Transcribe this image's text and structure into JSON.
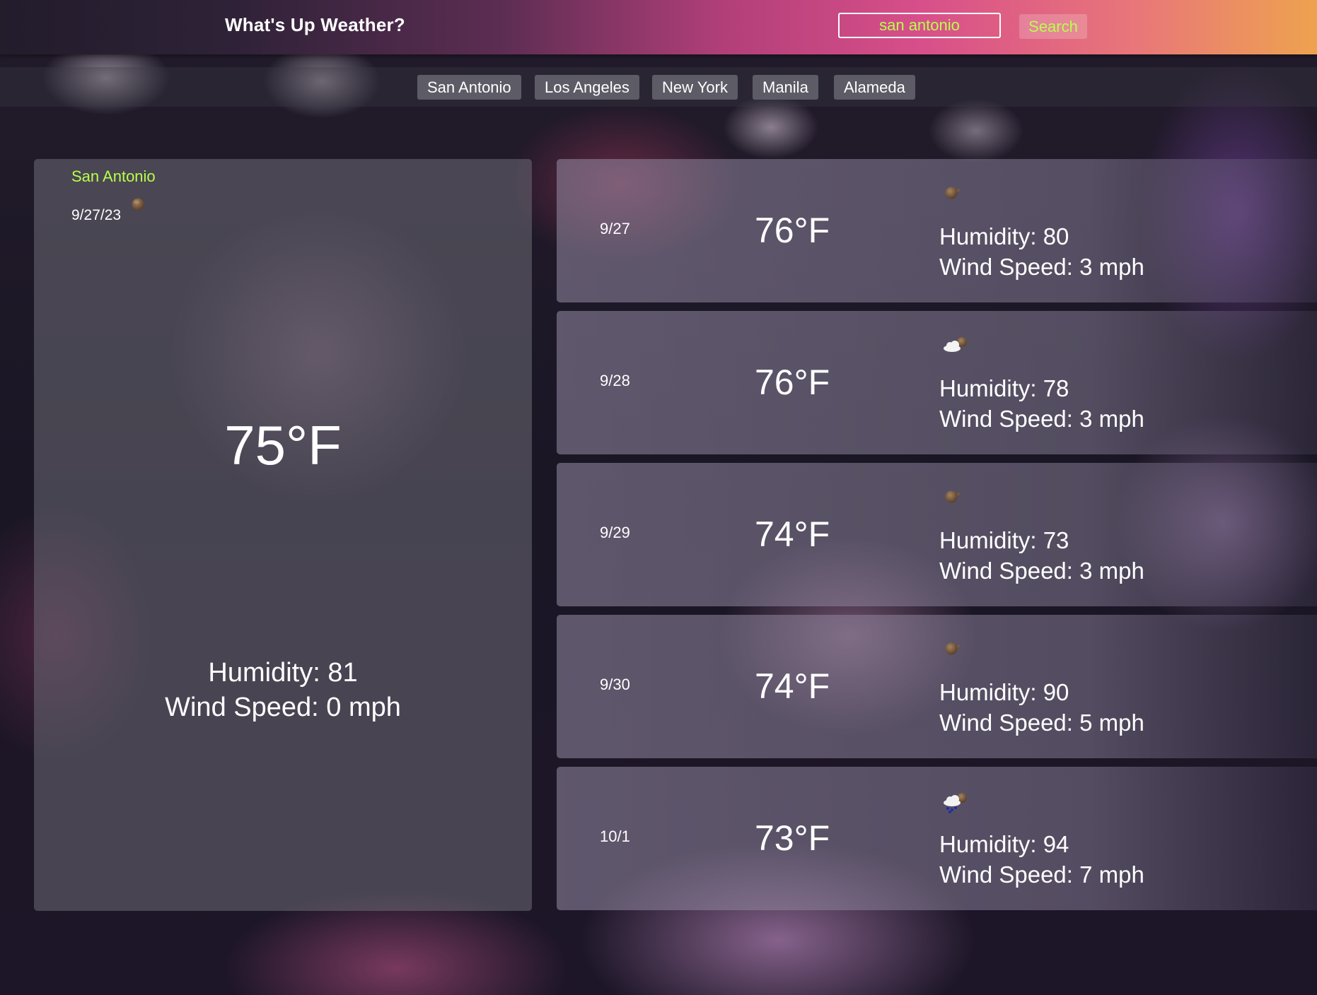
{
  "app": {
    "title": "What's Up Weather?"
  },
  "search": {
    "value": "san antonio",
    "button_label": "Search"
  },
  "cities": [
    "San Antonio",
    "Los Angeles",
    "New York",
    "Manila",
    "Alameda"
  ],
  "current": {
    "city": "San Antonio",
    "date": "9/27/23",
    "icon": "clear-night-icon",
    "temp": "75°F",
    "humidity": "Humidity: 81",
    "wind": "Wind Speed: 0 mph"
  },
  "forecast": [
    {
      "date": "9/27",
      "temp": "76°F",
      "icon": "clear-night-icon",
      "humidity": "Humidity: 80",
      "wind": "Wind Speed: 3 mph"
    },
    {
      "date": "9/28",
      "temp": "76°F",
      "icon": "cloudy-night-icon",
      "humidity": "Humidity: 78",
      "wind": "Wind Speed: 3 mph"
    },
    {
      "date": "9/29",
      "temp": "74°F",
      "icon": "clear-night-icon",
      "humidity": "Humidity: 73",
      "wind": "Wind Speed: 3 mph"
    },
    {
      "date": "9/30",
      "temp": "74°F",
      "icon": "clear-night-icon",
      "humidity": "Humidity: 90",
      "wind": "Wind Speed: 5 mph"
    },
    {
      "date": "10/1",
      "temp": "73°F",
      "icon": "rain-night-icon",
      "humidity": "Humidity: 94",
      "wind": "Wind Speed: 7 mph"
    }
  ],
  "colors": {
    "accent": "#b7ff4a",
    "header_start": "#221c2b",
    "header_end": "#eea24f"
  }
}
